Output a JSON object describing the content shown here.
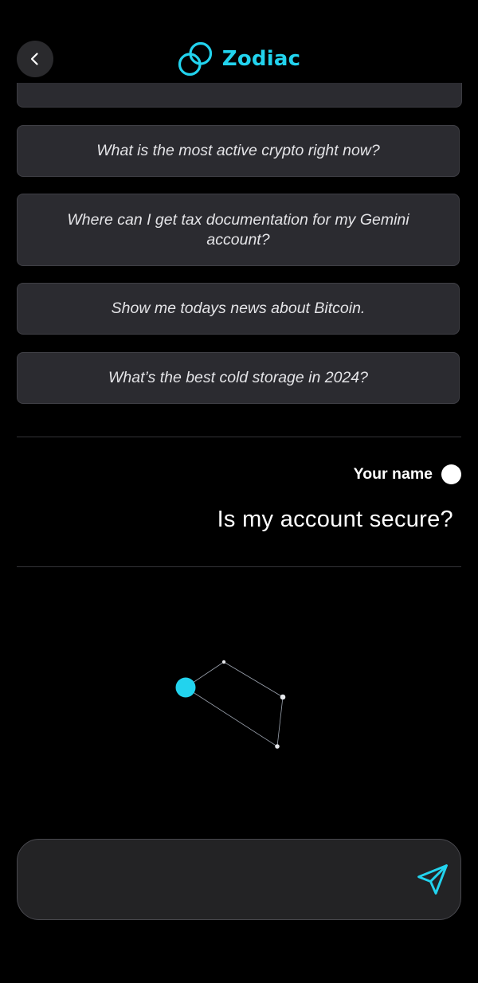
{
  "app": {
    "name": "Zodiac",
    "accent_color": "#22d3ee"
  },
  "header": {
    "back_icon": "chevron-left-icon",
    "logo_icon": "gemini-logo-icon"
  },
  "suggestions": [
    {
      "label": "What is the most active crypto right now?"
    },
    {
      "label": "Where can I get tax documentation for my Gemini account?"
    },
    {
      "label": "Show me todays news about Bitcoin."
    },
    {
      "label": "What’s the best cold storage in 2024?"
    }
  ],
  "conversation": {
    "user": {
      "name": "Your name",
      "message": "Is my account secure?"
    },
    "assistant_status_icon": "constellation-loading-icon"
  },
  "composer": {
    "value": "",
    "send_icon": "send-icon"
  }
}
